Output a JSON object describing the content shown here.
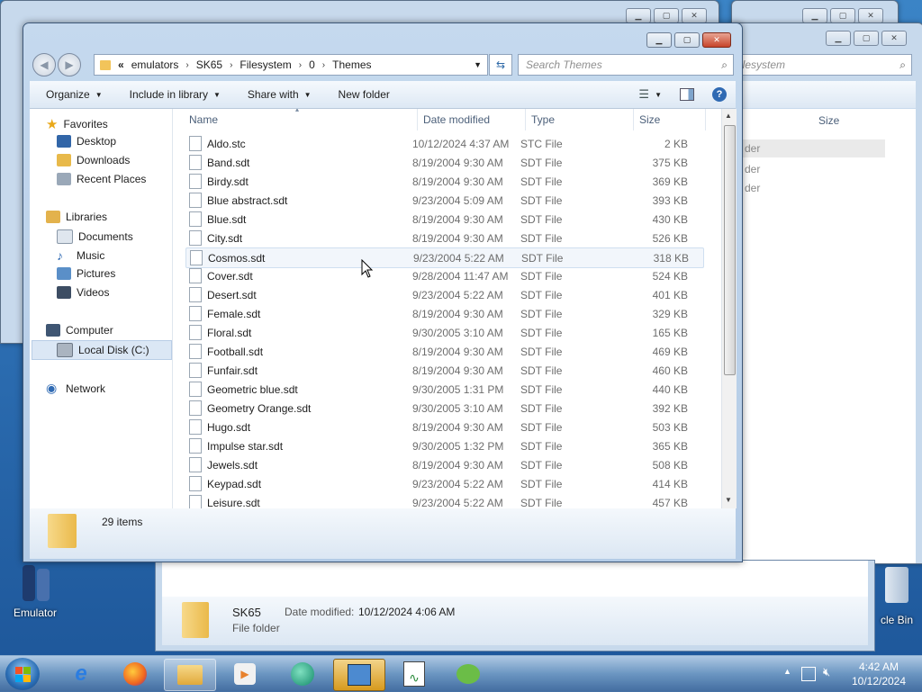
{
  "main": {
    "address": {
      "prefix": "«",
      "crumbs": [
        "emulators",
        "SK65",
        "Filesystem",
        "0",
        "Themes"
      ]
    },
    "search_placeholder": "Search Themes",
    "toolbar": {
      "organize": "Organize",
      "include_in_library": "Include in library",
      "share_with": "Share with",
      "new_folder": "New folder"
    },
    "nav": {
      "favorites": "Favorites",
      "desktop": "Desktop",
      "downloads": "Downloads",
      "recent_places": "Recent Places",
      "libraries": "Libraries",
      "documents": "Documents",
      "music": "Music",
      "pictures": "Pictures",
      "videos": "Videos",
      "computer": "Computer",
      "local_disk": "Local Disk (C:)",
      "network": "Network"
    },
    "columns": {
      "name": "Name",
      "date": "Date modified",
      "type": "Type",
      "size": "Size"
    },
    "files": [
      {
        "name": "Aldo.stc",
        "date": "10/12/2024 4:37 AM",
        "type": "STC File",
        "size": "2 KB"
      },
      {
        "name": "Band.sdt",
        "date": "8/19/2004 9:30 AM",
        "type": "SDT File",
        "size": "375 KB"
      },
      {
        "name": "Birdy.sdt",
        "date": "8/19/2004 9:30 AM",
        "type": "SDT File",
        "size": "369 KB"
      },
      {
        "name": "Blue abstract.sdt",
        "date": "9/23/2004 5:09 AM",
        "type": "SDT File",
        "size": "393 KB"
      },
      {
        "name": "Blue.sdt",
        "date": "8/19/2004 9:30 AM",
        "type": "SDT File",
        "size": "430 KB"
      },
      {
        "name": "City.sdt",
        "date": "8/19/2004 9:30 AM",
        "type": "SDT File",
        "size": "526 KB"
      },
      {
        "name": "Cosmos.sdt",
        "date": "9/23/2004 5:22 AM",
        "type": "SDT File",
        "size": "318 KB"
      },
      {
        "name": "Cover.sdt",
        "date": "9/28/2004 11:47 AM",
        "type": "SDT File",
        "size": "524 KB"
      },
      {
        "name": "Desert.sdt",
        "date": "9/23/2004 5:22 AM",
        "type": "SDT File",
        "size": "401 KB"
      },
      {
        "name": "Female.sdt",
        "date": "8/19/2004 9:30 AM",
        "type": "SDT File",
        "size": "329 KB"
      },
      {
        "name": "Floral.sdt",
        "date": "9/30/2005 3:10 AM",
        "type": "SDT File",
        "size": "165 KB"
      },
      {
        "name": "Football.sdt",
        "date": "8/19/2004 9:30 AM",
        "type": "SDT File",
        "size": "469 KB"
      },
      {
        "name": "Funfair.sdt",
        "date": "8/19/2004 9:30 AM",
        "type": "SDT File",
        "size": "460 KB"
      },
      {
        "name": "Geometric blue.sdt",
        "date": "9/30/2005 1:31 PM",
        "type": "SDT File",
        "size": "440 KB"
      },
      {
        "name": "Geometry Orange.sdt",
        "date": "9/30/2005 3:10 AM",
        "type": "SDT File",
        "size": "392 KB"
      },
      {
        "name": "Hugo.sdt",
        "date": "8/19/2004 9:30 AM",
        "type": "SDT File",
        "size": "503 KB"
      },
      {
        "name": "Impulse star.sdt",
        "date": "9/30/2005 1:32 PM",
        "type": "SDT File",
        "size": "365 KB"
      },
      {
        "name": "Jewels.sdt",
        "date": "8/19/2004 9:30 AM",
        "type": "SDT File",
        "size": "508 KB"
      },
      {
        "name": "Keypad.sdt",
        "date": "9/23/2004 5:22 AM",
        "type": "SDT File",
        "size": "414 KB"
      },
      {
        "name": "Leisure.sdt",
        "date": "9/23/2004 5:22 AM",
        "type": "SDT File",
        "size": "457 KB"
      }
    ],
    "status": {
      "count": "29 items"
    }
  },
  "back_window": {
    "search_fragment": "ilesystem",
    "size_col": "Size",
    "rows": [
      "der",
      "der",
      "der"
    ]
  },
  "lower_window": {
    "name": "SK65",
    "date_label": "Date modified:",
    "date_value": "10/12/2024 4:06 AM",
    "type": "File folder"
  },
  "desktop": {
    "emulator_label": "Emulator",
    "recycle_label": "cle Bin"
  },
  "taskbar": {
    "time": "4:42 AM",
    "date": "10/12/2024"
  },
  "colors": {
    "accent": "#3b84c6",
    "window_frame": "#c5d9ee",
    "folder": "#f2c45a"
  }
}
